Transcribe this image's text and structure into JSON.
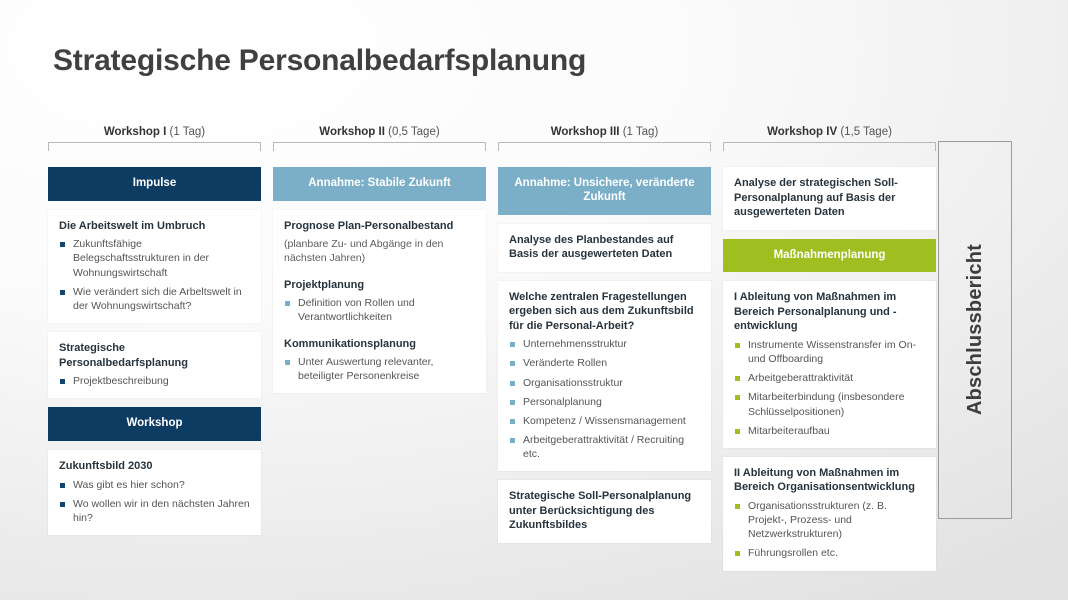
{
  "slide": {
    "title": "Strategische Personalbedarfsplanung"
  },
  "report": {
    "label": "Abschlussbericht"
  },
  "colors": {
    "navy": "#0d3c63",
    "light_blue": "#7bafc7",
    "green": "#9fbe1f",
    "background": "#e2e2e2"
  },
  "columns": [
    {
      "workshop_name": "Workshop I",
      "duration": "(1 Tag)",
      "blocks": [
        {
          "kind": "banner",
          "style": "dark",
          "label": "Impulse"
        },
        {
          "kind": "card",
          "groups": [
            {
              "title": "Die Arbeitswelt im Umbruch",
              "bullets": [
                "Zukunftsfähige Belegschaftsstrukturen in der Wohnungswirtschaft",
                "Wie verändert sich die Arbeltswelt in der Wohnungswirtschaft?"
              ]
            }
          ]
        },
        {
          "kind": "card",
          "groups": [
            {
              "title": "Strategische Personalbedarfsplanung",
              "bullets": [
                "Projektbeschreibung"
              ]
            }
          ]
        },
        {
          "kind": "banner",
          "style": "dark",
          "label": "Workshop"
        },
        {
          "kind": "card",
          "groups": [
            {
              "title": "Zukunftsbild 2030",
              "bullets": [
                "Was gibt es hier schon?",
                "Wo wollen wir in den nächsten Jahren hin?"
              ]
            }
          ]
        }
      ]
    },
    {
      "workshop_name": "Workshop II",
      "duration": "(0,5 Tage)",
      "blocks": [
        {
          "kind": "banner",
          "style": "light",
          "label": "Annahme: Stabile Zukunft"
        },
        {
          "kind": "card",
          "groups": [
            {
              "title": "Prognose Plan-Personalbestand",
              "note": "(planbare Zu- und Abgänge in den nächsten Jahren)",
              "bullets": []
            },
            {
              "title": "Projektplanung",
              "bullets": [
                "Definition von Rollen und Verantwortlichkeiten"
              ]
            },
            {
              "title": "Kommunikationsplanung",
              "bullets": [
                "Unter Auswertung relevanter, beteiligter Personenkreise"
              ]
            }
          ]
        }
      ]
    },
    {
      "workshop_name": "Workshop III",
      "duration": "(1 Tag)",
      "blocks": [
        {
          "kind": "banner",
          "style": "light",
          "label": "Annahme: Unsichere, veränderte Zukunft"
        },
        {
          "kind": "card",
          "groups": [
            {
              "title": "Analyse des Planbestandes auf Basis der ausgewerteten Daten",
              "bullets": []
            }
          ]
        },
        {
          "kind": "card",
          "groups": [
            {
              "title": "Welche zentralen Fragestellungen ergeben sich aus dem Zukunftsbild für die Personal-Arbeit?",
              "bullets": [
                "Unternehmensstruktur",
                "Veränderte Rollen",
                "Organisationsstruktur",
                "Personalplanung",
                "Kompetenz / Wissensmanagement",
                "Arbeitgeberattraktivität / Recruiting etc."
              ]
            }
          ]
        },
        {
          "kind": "card",
          "groups": [
            {
              "title": "Strategische Soll-Personalplanung unter Berücksichtigung des Zukunftsbildes",
              "bullets": []
            }
          ]
        }
      ]
    },
    {
      "workshop_name": "Workshop IV",
      "duration": "(1,5 Tage)",
      "blocks": [
        {
          "kind": "card",
          "groups": [
            {
              "title": "Analyse der strategischen Soll-Personalplanung auf Basis der ausgewerteten Daten",
              "bullets": []
            }
          ]
        },
        {
          "kind": "banner",
          "style": "green",
          "label": "Maßnahmenplanung"
        },
        {
          "kind": "card",
          "groups": [
            {
              "title": "I Ableitung von Maßnahmen im Bereich Personalplanung und -entwicklung",
              "bullets": [
                "Instrumente Wissenstransfer im On- und Offboarding",
                "Arbeitgeberattraktivität",
                "Mitarbeiterbindung (insbesondere Schlüsselpositionen)",
                "Mitarbeiteraufbau"
              ]
            }
          ]
        },
        {
          "kind": "card",
          "groups": [
            {
              "title": "II Ableitung von Maßnahmen im Bereich Organisationsentwicklung",
              "bullets": [
                "Organisationsstrukturen (z. B. Projekt-, Prozess- und Netzwerkstrukturen)",
                "Führungsrollen etc."
              ]
            }
          ]
        }
      ]
    }
  ]
}
